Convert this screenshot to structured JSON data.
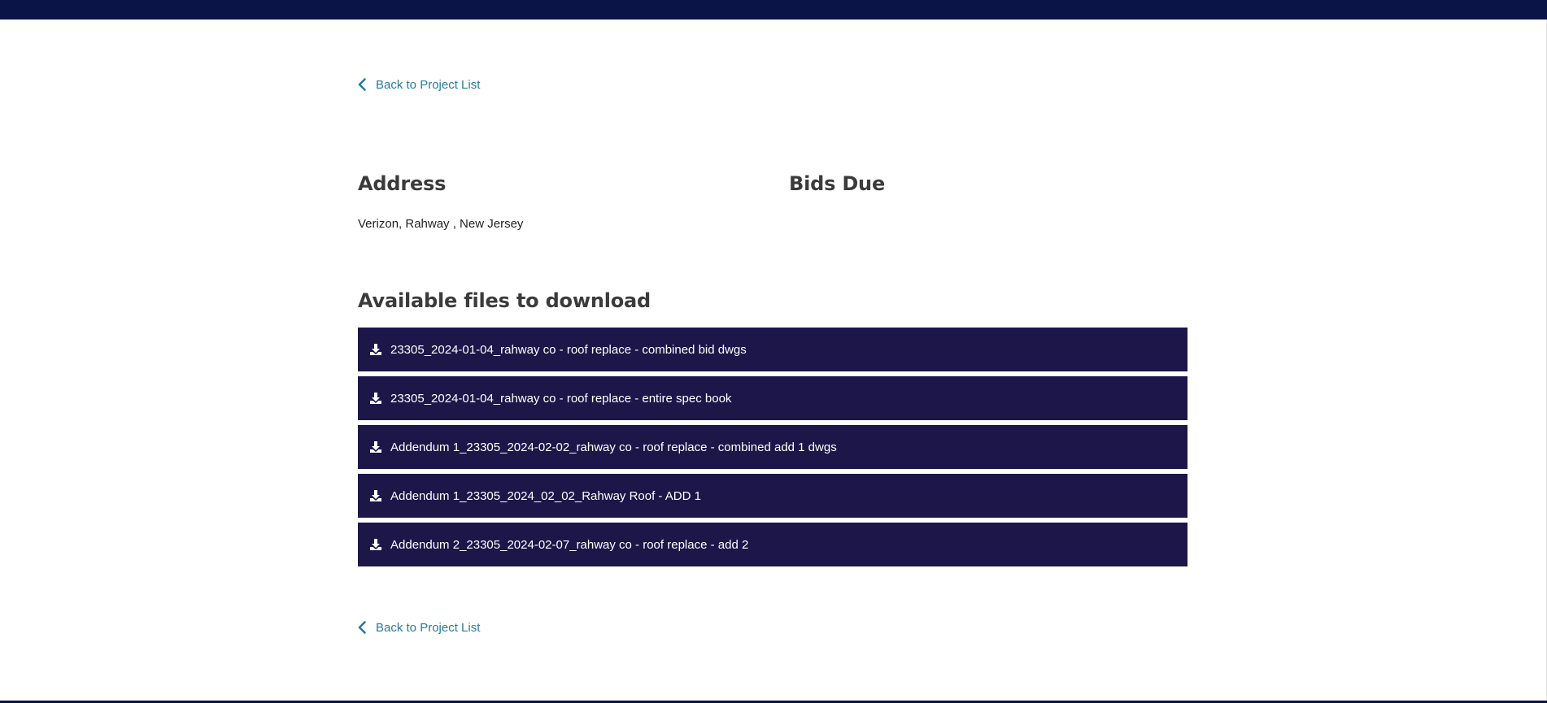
{
  "nav": {
    "back_label_top": "Back to Project List",
    "back_label_bottom": "Back to Project List"
  },
  "project": {
    "address_heading": "Address",
    "address_value": "Verizon, Rahway , New Jersey",
    "bids_due_heading": "Bids Due"
  },
  "files": {
    "heading": "Available files to download",
    "items": [
      {
        "label": "23305_2024-01-04_rahway co - roof replace - combined bid dwgs",
        "icon": "download-icon"
      },
      {
        "label": "23305_2024-01-04_rahway co - roof replace - entire spec book",
        "icon": "download-icon"
      },
      {
        "label": "Addendum 1_23305_2024-02-02_rahway co - roof replace - combined add 1 dwgs",
        "icon": "download-icon"
      },
      {
        "label": "Addendum 1_23305_2024_02_02_Rahway Roof - ADD 1",
        "icon": "download-icon"
      },
      {
        "label": "Addendum 2_23305_2024-02-07_rahway co - roof replace - add 2",
        "icon": "download-icon"
      }
    ]
  },
  "colors": {
    "header": "#0b1447",
    "file_row": "#1c1649",
    "link": "#2a7a9e",
    "heading": "#3b3b3b"
  }
}
